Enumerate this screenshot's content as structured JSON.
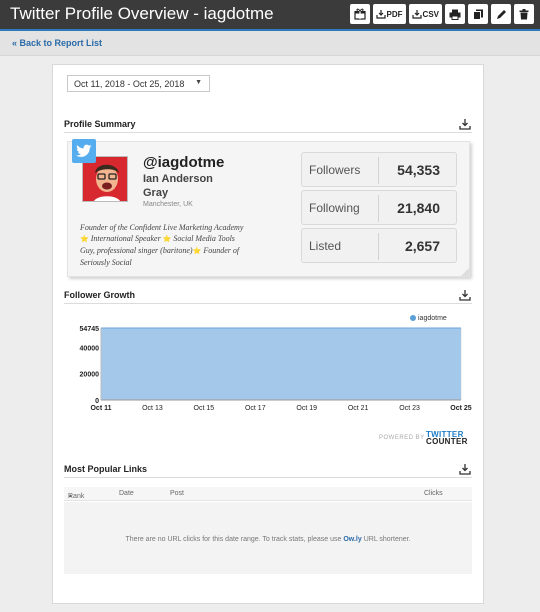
{
  "header": {
    "title": "Twitter Profile Overview - iagdotme",
    "toolbar": {
      "pdf_label": "PDF",
      "csv_label": "CSV"
    }
  },
  "nav": {
    "back_label": "« Back to Report List"
  },
  "filters": {
    "date_range": "Oct 11, 2018 - Oct 25, 2018"
  },
  "profile_summary": {
    "title": "Profile Summary",
    "handle": "@iagdotme",
    "name": "Ian Anderson Gray",
    "location": "Manchester, UK",
    "bio": {
      "line1": "Founder of the Confident Live Marketing Academy",
      "line2a": "International Speaker",
      "line2b": "Social Media Tools",
      "line3a": "Guy, professional singer (baritone)",
      "line3b": "Founder of",
      "line4": "Seriously Social"
    },
    "stats": [
      {
        "label": "Followers",
        "value": "54,353"
      },
      {
        "label": "Following",
        "value": "21,840"
      },
      {
        "label": "Listed",
        "value": "2,657"
      }
    ]
  },
  "follower_growth": {
    "title": "Follower Growth",
    "powered_by": "POWERED BY",
    "logo_top": "TWITTER",
    "logo_bottom": "COUNTER"
  },
  "chart_data": {
    "type": "area",
    "title": "Follower Growth",
    "x": [
      "Oct 11",
      "Oct 13",
      "Oct 15",
      "Oct 17",
      "Oct 19",
      "Oct 21",
      "Oct 23",
      "Oct 25"
    ],
    "series": [
      {
        "name": "iagdotme",
        "values": [
          54745,
          54745,
          54745,
          54745,
          54745,
          54745,
          54745,
          54745
        ]
      }
    ],
    "y_ticks": [
      "54745",
      "40000",
      "20000",
      "0"
    ],
    "ylim": [
      0,
      54745
    ],
    "grid": true,
    "legend_position": "top-right",
    "colors": {
      "fill": "#a3c8ea",
      "line": "#6aa6da"
    }
  },
  "popular_links": {
    "title": "Most Popular Links",
    "columns": [
      "Rank",
      "Date",
      "Post",
      "Clicks"
    ],
    "empty_text_prefix": "There are no URL clicks for this date range. To track stats, please use ",
    "empty_link": "Ow.ly",
    "empty_text_suffix": " URL shortener."
  },
  "colors": {
    "accent": "#2f7bbf",
    "twitter": "#55acee",
    "header_bg": "#3b3b3b"
  }
}
